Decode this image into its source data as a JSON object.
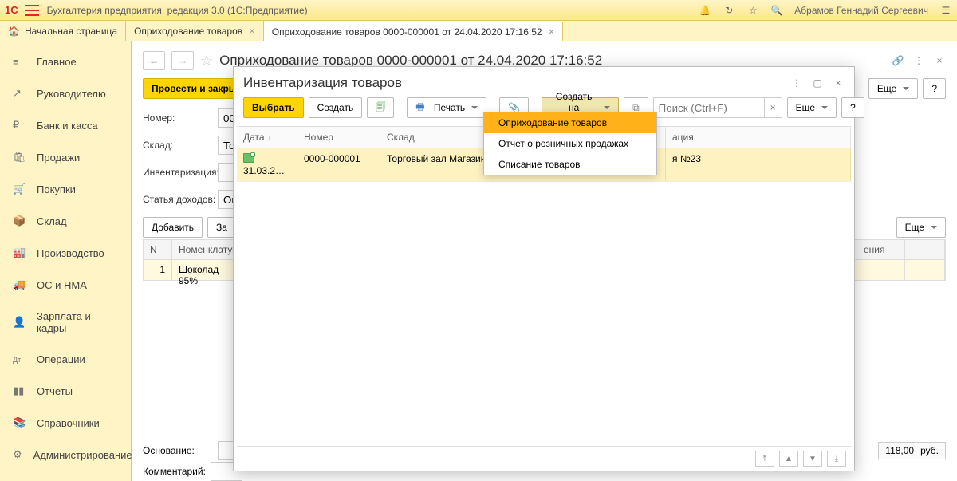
{
  "topbar": {
    "logo": "1C",
    "title": "Бухгалтерия предприятия, редакция 3.0  (1С:Предприятие)",
    "user": "Абрамов Геннадий Сергеевич"
  },
  "tabs": {
    "home": "Начальная страница",
    "t1": "Оприходование товаров",
    "t2": "Оприходование товаров 0000-000001 от 24.04.2020 17:16:52"
  },
  "sidebar": {
    "items": [
      {
        "icon": "≡",
        "label": "Главное"
      },
      {
        "icon": "↗",
        "label": "Руководителю"
      },
      {
        "icon": "₽",
        "label": "Банк и касса"
      },
      {
        "icon": "🛍",
        "label": "Продажи"
      },
      {
        "icon": "🛒",
        "label": "Покупки"
      },
      {
        "icon": "📦",
        "label": "Склад"
      },
      {
        "icon": "🏭",
        "label": "Производство"
      },
      {
        "icon": "🚚",
        "label": "ОС и НМА"
      },
      {
        "icon": "👤",
        "label": "Зарплата и кадры"
      },
      {
        "icon": "Дт",
        "label": "Операции"
      },
      {
        "icon": "▮▮",
        "label": "Отчеты"
      },
      {
        "icon": "📚",
        "label": "Справочники"
      },
      {
        "icon": "⚙",
        "label": "Администрирование"
      }
    ]
  },
  "doc": {
    "title": "Оприходование товаров 0000-000001 от 24.04.2020 17:16:52",
    "post_close": "Провести и закрыть",
    "more": "Еще",
    "help": "?",
    "labels": {
      "number": "Номер:",
      "warehouse": "Склад:",
      "inventory": "Инвентаризация:",
      "income": "Статья доходов:",
      "basis": "Основание:",
      "comment": "Комментарий:"
    },
    "values": {
      "number": "000",
      "warehouse": "Тор",
      "income": "Оп"
    },
    "add": "Добавить",
    "fill": "За",
    "cols": {
      "n": "N",
      "item": "Номенклатур",
      "price_last": "ения"
    },
    "row": {
      "n": "1",
      "item": "Шоколад 95%"
    },
    "sum": "118,00",
    "currency": "руб."
  },
  "dialog": {
    "title": "Инвентаризация товаров",
    "select": "Выбрать",
    "create": "Создать",
    "print": "Печать",
    "create_based": "Создать на основании",
    "search_placeholder": "Поиск (Ctrl+F)",
    "more": "Еще",
    "help": "?",
    "cols": {
      "date": "Дата",
      "num": "Номер",
      "sklad": "Склад",
      "otv": "ация"
    },
    "row": {
      "date": "31.03.2…",
      "num": "0000-000001",
      "sklad": "Торговый зал Магазина N",
      "otv": "я №23"
    }
  },
  "menu": {
    "i1": "Оприходование товаров",
    "i2": "Отчет о розничных продажах",
    "i3": "Списание товаров"
  }
}
